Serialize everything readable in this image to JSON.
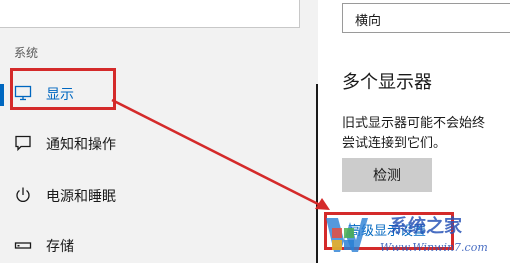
{
  "sidebar": {
    "section_label": "系统",
    "items": [
      {
        "label": "显示",
        "icon": "monitor-icon",
        "selected": true
      },
      {
        "label": "通知和操作",
        "icon": "notification-icon",
        "selected": false
      },
      {
        "label": "电源和睡眠",
        "icon": "power-icon",
        "selected": false
      },
      {
        "label": "存储",
        "icon": "storage-icon",
        "selected": false
      }
    ]
  },
  "main": {
    "orientation_value": "横向",
    "multiple_displays_title": "多个显示器",
    "desc_line1": "旧式显示器可能不会始终",
    "desc_line2": "尝试连接到它们。",
    "detect_label": "检测",
    "advanced_link": "高级显示设置"
  },
  "watermark": {
    "name": "系统之家",
    "url": "Www.Winwin7.com"
  },
  "colors": {
    "accent": "#0067c0",
    "annotation": "#d42a2a",
    "sidebar_bg": "#f2f2f2"
  }
}
